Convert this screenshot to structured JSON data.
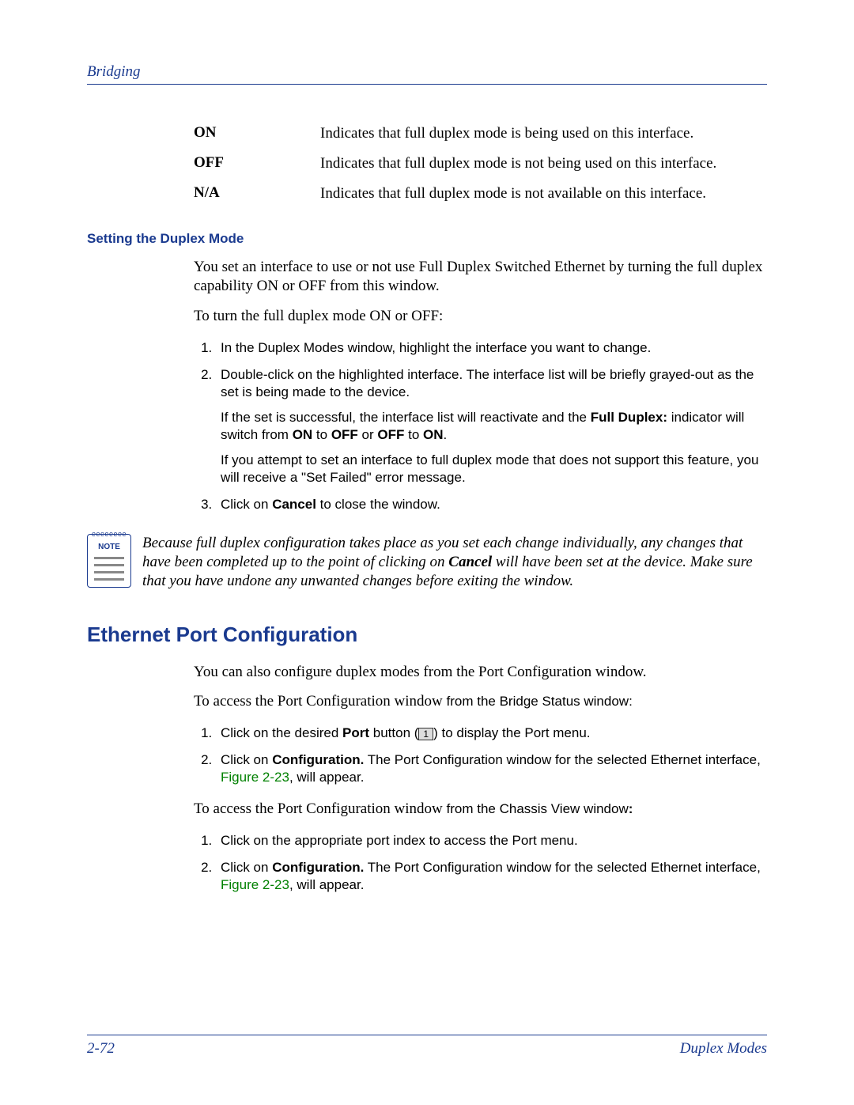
{
  "header": {
    "title": "Bridging"
  },
  "defs": [
    {
      "term": "ON",
      "desc": "Indicates that full duplex mode is being used on this interface."
    },
    {
      "term": "OFF",
      "desc": "Indicates that full duplex mode is not being used on this interface."
    },
    {
      "term": "N/A",
      "desc": "Indicates that full duplex mode is not available on this interface."
    }
  ],
  "sub1": "Setting the Duplex Mode",
  "p1": "You set an interface to use or not use Full Duplex Switched Ethernet by turning the full duplex capability ON or OFF from this window.",
  "p2": "To turn the full duplex mode ON or OFF:",
  "steps1": {
    "s1": "In the Duplex Modes window, highlight the interface you want to change.",
    "s2": "Double-click on the highlighted interface. The interface list will be briefly grayed-out as the set is being made to the device.",
    "s2a_pre": "If the set is successful, the interface list will reactivate and the ",
    "s2a_bold1": "Full Duplex:",
    "s2a_mid": " indicator will switch from ",
    "s2a_on": "ON",
    "s2a_to": " to ",
    "s2a_off": "OFF",
    "s2a_or": " or ",
    "s2a_off2": "OFF",
    "s2a_to2": " to ",
    "s2a_on2": "ON",
    "s2a_end": ".",
    "s2b": "If you attempt to set an interface to full duplex mode that does not support this feature, you will receive a \"Set Failed\" error message.",
    "s3_pre": "Click on ",
    "s3_bold": "Cancel",
    "s3_post": " to close the window."
  },
  "note": {
    "label": "NOTE",
    "pre": "Because full duplex configuration takes place as you set each change individually, any changes that have been completed up to the point of clicking on ",
    "bold": "Cancel",
    "post": " will have been set at the device. Make sure that you have undone any unwanted changes before exiting the window."
  },
  "h2": "Ethernet Port Configuration",
  "p3": "You can also configure duplex modes from the Port Configuration window.",
  "p4_pre": "To access the Port Configuration window ",
  "p4_post": "from the Bridge Status window:",
  "stepsA": {
    "s1_pre": "Click on the desired ",
    "s1_bold": "Port",
    "s1_mid": " button (",
    "s1_btn": "1",
    "s1_post": ") to display the Port menu.",
    "s2_pre": "Click on ",
    "s2_bold": "Configuration.",
    "s2_mid": " The Port Configuration window for the selected Ethernet interface, ",
    "s2_link": "Figure 2-23",
    "s2_post": ", will appear."
  },
  "p5_pre": "To access the Port Configuration window ",
  "p5_post": "from the Chassis View window",
  "p5_colon": ":",
  "stepsB": {
    "s1": "Click on the appropriate port index to access the Port menu.",
    "s2_pre": "Click on ",
    "s2_bold": "Configuration.",
    "s2_mid": " The Port Configuration window for the selected Ethernet interface, ",
    "s2_link": "Figure 2-23",
    "s2_post": ", will appear."
  },
  "footer": {
    "left": "2-72",
    "right": "Duplex Modes"
  }
}
